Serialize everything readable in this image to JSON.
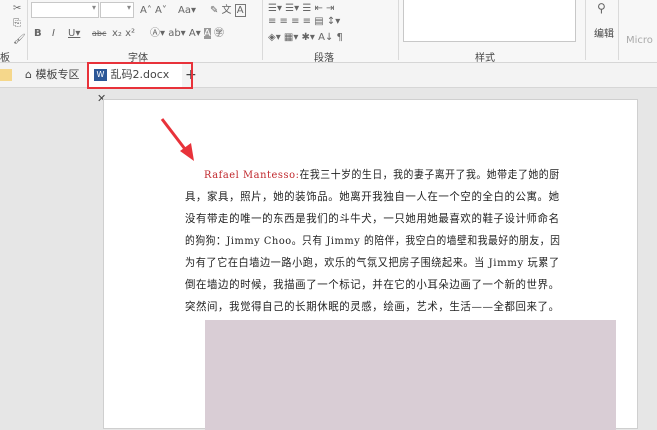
{
  "ribbon": {
    "groups": [
      {
        "label": "板"
      },
      {
        "label": "字体"
      },
      {
        "label": "段落"
      },
      {
        "label": "样式"
      }
    ],
    "edit_label": "编辑",
    "partial_label": "Micro"
  },
  "tabs": [
    {
      "label": "模板专区",
      "icon": "home-icon"
    },
    {
      "label": "乱码2.docx",
      "icon": "word-doc-icon",
      "active": true
    }
  ],
  "document": {
    "speaker": "Rafael Mantesso:",
    "lines": [
      "在我三十岁的生日，我的妻子离开了我。她带走了她的厨",
      "具，家具，照片，她的装饰品。她离开我独自一人在一个空的全白的公寓。她",
      "没有带走的唯一的东西是我们的斗牛犬，一只她用她最喜欢的鞋子设计师命名",
      "的狗狗：Jimmy Choo。只有 Jimmy 的陪伴，我空白的墙壁和我最好的朋友，因",
      "为有了它在白墙边一路小跑，欢乐的气氛又把房子围绕起来。当 Jimmy 玩累了",
      "倒在墙边的时候，我描画了一个标记，并在它的小耳朵边画了一个新的世界。",
      "突然间，我觉得自己的长期休眠的灵感，绘画，艺术，生活——全都回来了。"
    ]
  },
  "colors": {
    "highlight": "#e8323a",
    "speaker": "#c0282d",
    "image": "#d9cdd5"
  }
}
